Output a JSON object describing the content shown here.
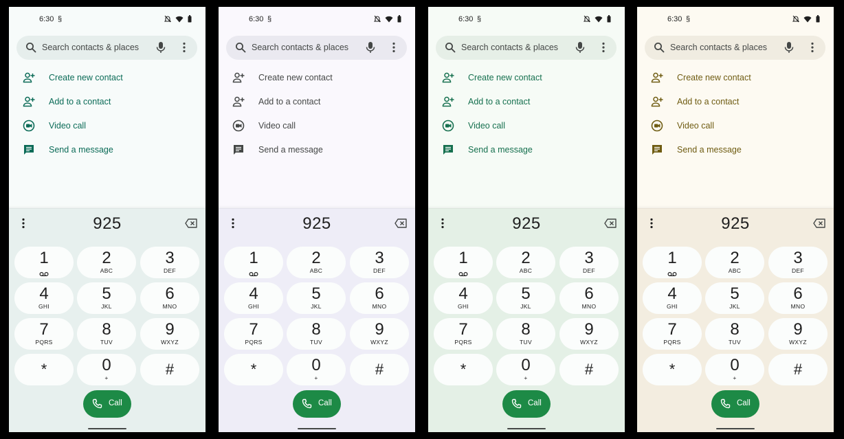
{
  "panels": [
    {
      "theme": {
        "bg": "#f7fbfa",
        "search_bg": "#e6eeec",
        "accent": "#0b6b57",
        "pad_bg": "#e7f0ee"
      },
      "status": {
        "time": "6:30"
      },
      "search": {
        "placeholder": "Search contacts & places"
      },
      "actions": [
        "Create new contact",
        "Add to a contact",
        "Video call",
        "Send a message"
      ],
      "dialed": "925",
      "call_label": "Call"
    },
    {
      "theme": {
        "bg": "#faf8fd",
        "search_bg": "#eae9f0",
        "accent": "#444746",
        "pad_bg": "#eeedf7"
      },
      "status": {
        "time": "6:30"
      },
      "search": {
        "placeholder": "Search contacts & places"
      },
      "actions": [
        "Create new contact",
        "Add to a contact",
        "Video call",
        "Send a message"
      ],
      "dialed": "925",
      "call_label": "Call"
    },
    {
      "theme": {
        "bg": "#f6fbf6",
        "search_bg": "#e6efe7",
        "accent": "#16704f",
        "pad_bg": "#e4f0e6"
      },
      "status": {
        "time": "6:30"
      },
      "search": {
        "placeholder": "Search contacts & places"
      },
      "actions": [
        "Create new contact",
        "Add to a contact",
        "Video call",
        "Send a message"
      ],
      "dialed": "925",
      "call_label": "Call"
    },
    {
      "theme": {
        "bg": "#fdfaf2",
        "search_bg": "#f0ece1",
        "accent": "#6f5c12",
        "pad_bg": "#f3ede0"
      },
      "status": {
        "time": "6:30"
      },
      "search": {
        "placeholder": "Search contacts & places"
      },
      "actions": [
        "Create new contact",
        "Add to a contact",
        "Video call",
        "Send a message"
      ],
      "dialed": "925",
      "call_label": "Call"
    }
  ],
  "keypad": [
    {
      "digit": "1",
      "letters": "",
      "voicemail": true
    },
    {
      "digit": "2",
      "letters": "ABC"
    },
    {
      "digit": "3",
      "letters": "DEF"
    },
    {
      "digit": "4",
      "letters": "GHI"
    },
    {
      "digit": "5",
      "letters": "JKL"
    },
    {
      "digit": "6",
      "letters": "MNO"
    },
    {
      "digit": "7",
      "letters": "PQRS"
    },
    {
      "digit": "8",
      "letters": "TUV"
    },
    {
      "digit": "9",
      "letters": "WXYZ"
    },
    {
      "digit": "*",
      "letters": ""
    },
    {
      "digit": "0",
      "letters": "+"
    },
    {
      "digit": "#",
      "letters": ""
    }
  ],
  "icons": {
    "search": "search-icon",
    "mic": "mic-icon",
    "more": "more-vert-icon",
    "actions": [
      "person-add-icon",
      "person-add-icon",
      "video-call-icon",
      "message-icon"
    ],
    "backspace": "backspace-icon",
    "call": "phone-icon",
    "voicemail": "voicemail-icon"
  }
}
